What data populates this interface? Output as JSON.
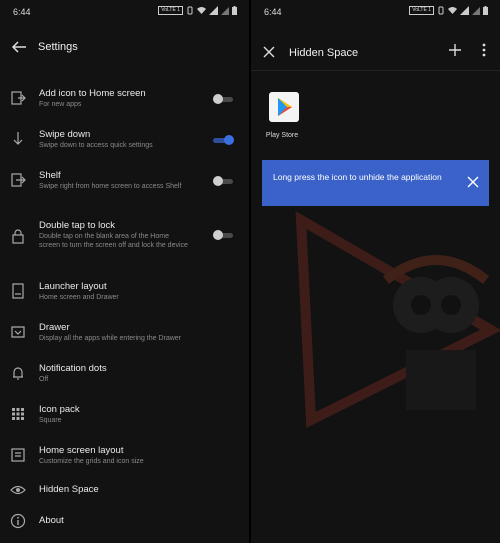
{
  "left": {
    "status": {
      "time": "6:44",
      "volte": "VoLTE 1"
    },
    "appbar": {
      "title": "Settings"
    },
    "items": [
      {
        "title": "Add icon to Home screen",
        "subtitle": "For new apps",
        "icon": "add-home-icon",
        "toggle": "off"
      },
      {
        "title": "Swipe down",
        "subtitle": "Swipe down to access quick settings",
        "icon": "swipe-down-icon",
        "toggle": "on"
      },
      {
        "title": "Shelf",
        "subtitle": "Swipe right from home screen to access Shelf",
        "icon": "shelf-icon",
        "toggle": "off"
      },
      {
        "title": "Double tap to lock",
        "subtitle": "Double tap on the blank area of the Home screen to turn the screen off and lock the device",
        "icon": "lock-icon",
        "toggle": "off"
      },
      {
        "title": "Launcher layout",
        "subtitle": "Home screen and Drawer",
        "icon": "layout-icon"
      },
      {
        "title": "Drawer",
        "subtitle": "Display all the apps while entering the Drawer",
        "icon": "drawer-icon"
      },
      {
        "title": "Notification dots",
        "subtitle": "Off",
        "icon": "bell-icon"
      },
      {
        "title": "Icon pack",
        "subtitle": "Square",
        "icon": "grid-icon"
      },
      {
        "title": "Home screen layout",
        "subtitle": "Customize the grids and icon size",
        "icon": "home-layout-icon"
      },
      {
        "title": "Hidden Space",
        "subtitle": "",
        "icon": "eye-icon"
      },
      {
        "title": "About",
        "subtitle": "",
        "icon": "info-icon"
      }
    ]
  },
  "right": {
    "status": {
      "time": "6:44",
      "volte": "VoLTE 1"
    },
    "appbar": {
      "title": "Hidden Space"
    },
    "app": {
      "label": "Play Store"
    },
    "tip": {
      "message": "Long press the icon to unhide the application"
    }
  },
  "colors": {
    "accent": "#3b6fe0",
    "tip_bg": "#3a62c9",
    "bg": "#121212"
  }
}
